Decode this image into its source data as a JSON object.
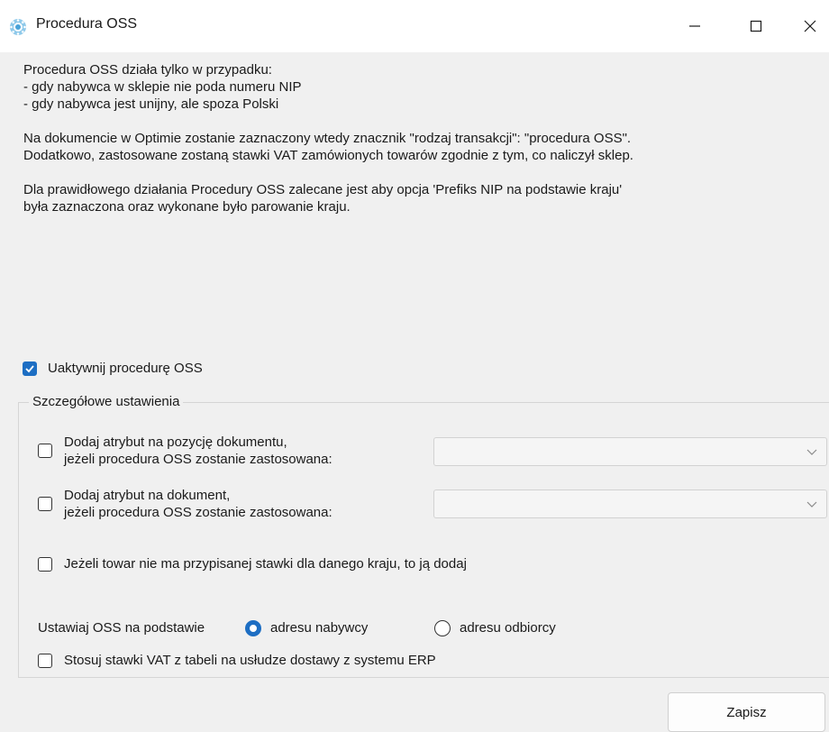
{
  "window": {
    "title": "Procedura OSS",
    "minimize_glyph": "—",
    "close_glyph": "✕"
  },
  "info": {
    "lines_block1": [
      "Procedura OSS działa tylko w przypadku:",
      "- gdy nabywca w sklepie nie poda numeru NIP",
      "- gdy nabywca jest unijny, ale spoza Polski"
    ],
    "lines_block2": [
      "Na dokumencie w Optimie zostanie zaznaczony wtedy znacznik \"rodzaj transakcji\": \"procedura OSS\".",
      "Dodatkowo, zastosowane zostaną stawki VAT zamówionych towarów zgodnie z tym, co naliczył sklep."
    ],
    "lines_block3": [
      "Dla prawidłowego działania Procedury OSS zalecane jest aby opcja 'Prefiks NIP na podstawie kraju'",
      "była zaznaczona oraz wykonane było parowanie kraju."
    ]
  },
  "activate": {
    "label": "Uaktywnij procedurę OSS",
    "checked": true
  },
  "details": {
    "legend": "Szczegółowe ustawienia",
    "position_attr": {
      "line1": "Dodaj atrybut na pozycję dokumentu,",
      "line2": "jeżeli procedura OSS zostanie zastosowana:",
      "checked": false,
      "combo_value": ""
    },
    "document_attr": {
      "line1": "Dodaj atrybut na dokument,",
      "line2": "jeżeli procedura OSS zostanie zastosowana:",
      "checked": false,
      "combo_value": ""
    },
    "add_rate": {
      "label": "Jeżeli towar nie ma przypisanej stawki dla danego kraju, to ją dodaj",
      "checked": false
    },
    "basis": {
      "label": "Ustawiaj OSS na podstawie",
      "option_buyer": "adresu nabywcy",
      "option_recipient": "adresu odbiorcy",
      "selected": "adresu nabywcy"
    },
    "vat_table": {
      "label": "Stosuj stawki VAT z tabeli na usłudze dostawy z systemu ERP",
      "checked": false
    }
  },
  "save_button": {
    "label": "Zapisz"
  },
  "colors": {
    "accent": "#1d6ec3",
    "titlebar": "#ffffff",
    "background": "#f0f0f0"
  }
}
